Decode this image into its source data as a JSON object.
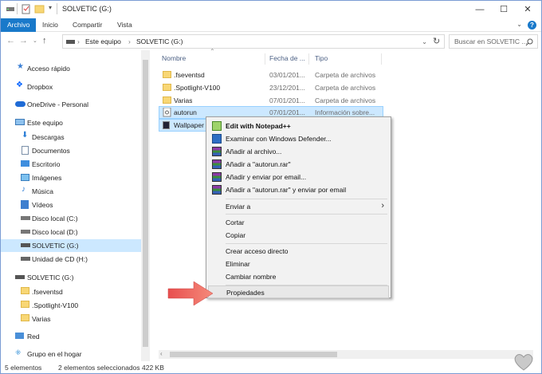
{
  "window": {
    "title": "SOLVETIC (G:)",
    "minimize": "—",
    "maximize": "☐",
    "close": "✕"
  },
  "ribbon": {
    "tabs": [
      "Archivo",
      "Inicio",
      "Compartir",
      "Vista"
    ],
    "help": "?"
  },
  "address": {
    "back": "←",
    "forward": "→",
    "up": "↑",
    "crumbs": [
      "Este equipo",
      "SOLVETIC (G:)"
    ],
    "separator": "›",
    "refresh": "↻",
    "search_placeholder": "Buscar en SOLVETIC ..."
  },
  "nav": {
    "items": [
      {
        "label": "Acceso rápido",
        "icon": "star-icon"
      },
      {
        "label": "Dropbox",
        "icon": "dropbox-icon"
      },
      {
        "label": "OneDrive - Personal",
        "icon": "cloud-icon"
      },
      {
        "label": "Este equipo",
        "icon": "computer-icon"
      },
      {
        "label": "Descargas",
        "icon": "download-icon"
      },
      {
        "label": "Documentos",
        "icon": "document-icon"
      },
      {
        "label": "Escritorio",
        "icon": "desktop-icon"
      },
      {
        "label": "Imágenes",
        "icon": "pictures-icon"
      },
      {
        "label": "Música",
        "icon": "music-icon"
      },
      {
        "label": "Vídeos",
        "icon": "video-icon"
      },
      {
        "label": "Disco local (C:)",
        "icon": "drive-icon"
      },
      {
        "label": "Disco local (D:)",
        "icon": "drive-icon"
      },
      {
        "label": "SOLVETIC (G:)",
        "icon": "usb-drive-icon"
      },
      {
        "label": "Unidad de CD (H:)",
        "icon": "cd-drive-icon"
      },
      {
        "label": "SOLVETIC (G:)",
        "icon": "usb-drive-icon"
      },
      {
        "label": ".fseventsd",
        "icon": "folder-icon"
      },
      {
        "label": ".Spotlight-V100",
        "icon": "folder-icon"
      },
      {
        "label": "Varias",
        "icon": "folder-icon"
      },
      {
        "label": "Red",
        "icon": "network-icon"
      },
      {
        "label": "Grupo en el hogar",
        "icon": "homegroup-icon"
      }
    ]
  },
  "files": {
    "columns": [
      "Nombre",
      "Fecha de ...",
      "Tipo"
    ],
    "rows": [
      {
        "name": ".fseventsd",
        "date": "03/01/201...",
        "type": "Carpeta de archivos"
      },
      {
        "name": ".Spotlight-V100",
        "date": "23/12/201...",
        "type": "Carpeta de archivos"
      },
      {
        "name": "Varias",
        "date": "07/01/201...",
        "type": "Carpeta de archivos"
      },
      {
        "name": "autorun",
        "date": "07/01/201...",
        "type": "Información sobre..."
      },
      {
        "name": "Wallpaper",
        "date": "",
        "type": ""
      }
    ]
  },
  "context_menu": {
    "items": [
      "Edit with Notepad++",
      "Examinar con Windows Defender...",
      "Añadir al archivo...",
      "Añadir a \"autorun.rar\"",
      "Añadir y enviar por email...",
      "Añadir a \"autorun.rar\" y enviar por email",
      "Enviar a",
      "Cortar",
      "Copiar",
      "Crear acceso directo",
      "Eliminar",
      "Cambiar nombre",
      "Propiedades"
    ],
    "submenu_arrow": "›"
  },
  "status": {
    "count": "5 elementos",
    "selected": "2 elementos seleccionados",
    "size": "422 KB"
  },
  "colors": {
    "accent": "#1979ca",
    "selection": "#cce8ff",
    "arrow": "#f26b6b"
  }
}
